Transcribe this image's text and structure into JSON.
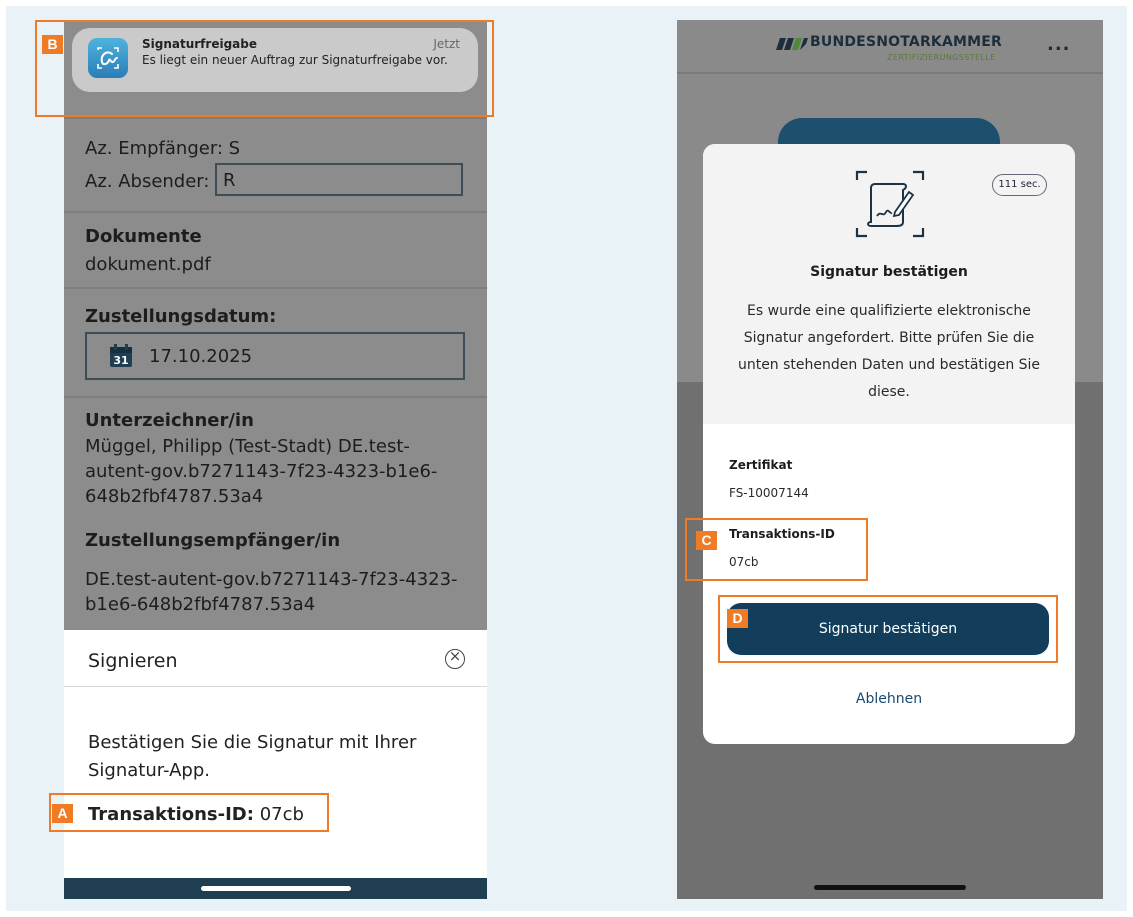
{
  "left_phone": {
    "notification": {
      "title": "Signaturfreigabe",
      "time": "Jetzt",
      "body": "Es liegt ein neuer Auftrag zur Signaturfreigabe vor.",
      "icon": "signature-app-icon"
    },
    "details": {
      "recipient_ref": "Az. Empfänger: S",
      "sender_ref_label": "Az. Absender:",
      "sender_ref_value": "R",
      "documents_heading": "Dokumente",
      "document_name": "dokument.pdf",
      "delivery_date_heading": "Zustellungsdatum:",
      "delivery_date": "17.10.2025",
      "calendar_day": "31",
      "signer_heading": "Unterzeichner/in",
      "signer_line1": "Müggel, Philipp (Test-Stadt) DE.test-",
      "signer_line2": "autent-gov.b7271143-7f23-4323-b1e6-",
      "signer_line3": "648b2fbf4787.53a4",
      "recipient_heading": "Zustellungsempfänger/in",
      "recipient_line1": "DE.test-autent-gov.b7271143-7f23-4323-",
      "recipient_line2": "b1e6-648b2fbf4787.53a4"
    },
    "sheet": {
      "title": "Signieren",
      "close_icon": "close-circle-icon",
      "close_glyph": "×",
      "message": "Bestätigen Sie die Signatur mit Ihrer Signatur-App.",
      "transaction_label": "Transaktions-ID:",
      "transaction_value": "07cb"
    }
  },
  "right_phone": {
    "header": {
      "logo": "BUNDESNOTARKAMMER",
      "logo_sub": "ZERTIFIZIERUNGSSTELLE",
      "more": "..."
    },
    "dialog": {
      "timer": "111 sec.",
      "title": "Signatur bestätigen",
      "description": "Es wurde eine qualifizierte elektronische Signatur angefordert. Bitte prüfen Sie die unten stehenden Daten und bestätigen Sie diese.",
      "certificate_label": "Zertifikat",
      "certificate_value": "FS-10007144",
      "transaction_label": "Transaktions-ID",
      "transaction_value": "07cb",
      "confirm_button": "Signatur bestätigen",
      "reject_link": "Ablehnen"
    }
  },
  "annotations": {
    "a": "A",
    "b": "B",
    "c": "C",
    "d": "D",
    "color": "#ef7c25"
  },
  "colors": {
    "background": "#e8f2f7",
    "primary_button": "#123e5c",
    "highlight": "#ef7c25"
  }
}
